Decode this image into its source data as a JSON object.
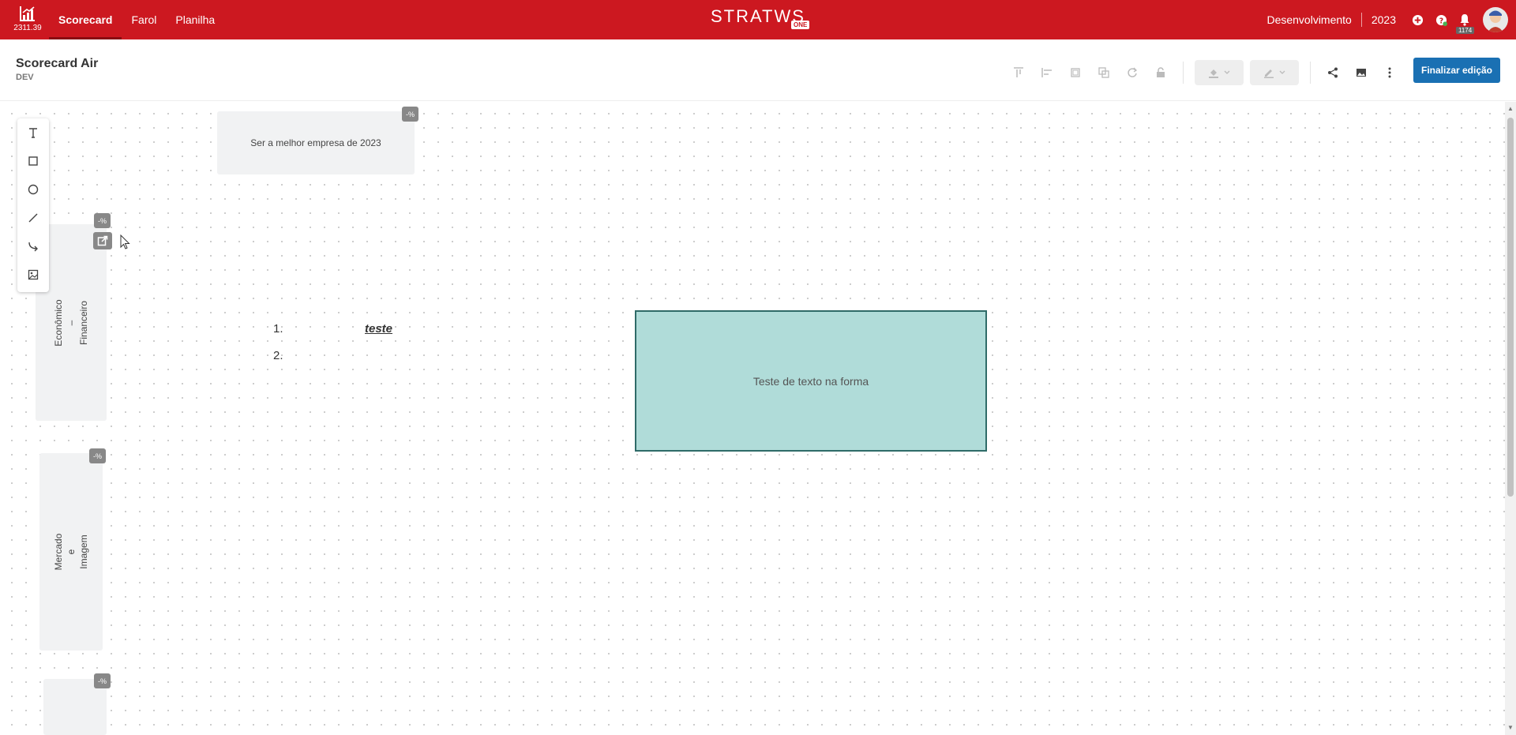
{
  "app": {
    "version": "2311.39",
    "nav": [
      {
        "label": "Scorecard",
        "active": true
      },
      {
        "label": "Farol",
        "active": false
      },
      {
        "label": "Planilha",
        "active": false
      }
    ],
    "logo": {
      "text": "STRATWS",
      "suffix": "ONE"
    },
    "environment": "Desenvolvimento",
    "year": "2023",
    "notification_count": "1174"
  },
  "page": {
    "title": "Scorecard Air",
    "subtitle": "DEV",
    "finish_button": "Finalizar edição"
  },
  "palette": [
    "text-icon",
    "rectangle-icon",
    "circle-icon",
    "line-icon",
    "connector-icon",
    "image-icon"
  ],
  "canvas": {
    "objective_card": {
      "text": "Ser a melhor empresa de 2023",
      "pct": "-%"
    },
    "perspectives": [
      {
        "lines": [
          "Econômico",
          "–",
          "Financeiro"
        ],
        "pct": "-%"
      },
      {
        "lines": [
          "Mercado",
          "e",
          "Imagem"
        ],
        "pct": "-%"
      },
      {
        "lines": [],
        "pct": "-%"
      }
    ],
    "list": [
      {
        "num": "1.",
        "text": "teste"
      },
      {
        "num": "2.",
        "text": ""
      }
    ],
    "shape_text": "Teste de texto na forma"
  },
  "colors": {
    "topbar": "#cc1820",
    "primary": "#1a70b3",
    "shape_fill": "#b0dcd9",
    "shape_border": "#2f6b68"
  }
}
